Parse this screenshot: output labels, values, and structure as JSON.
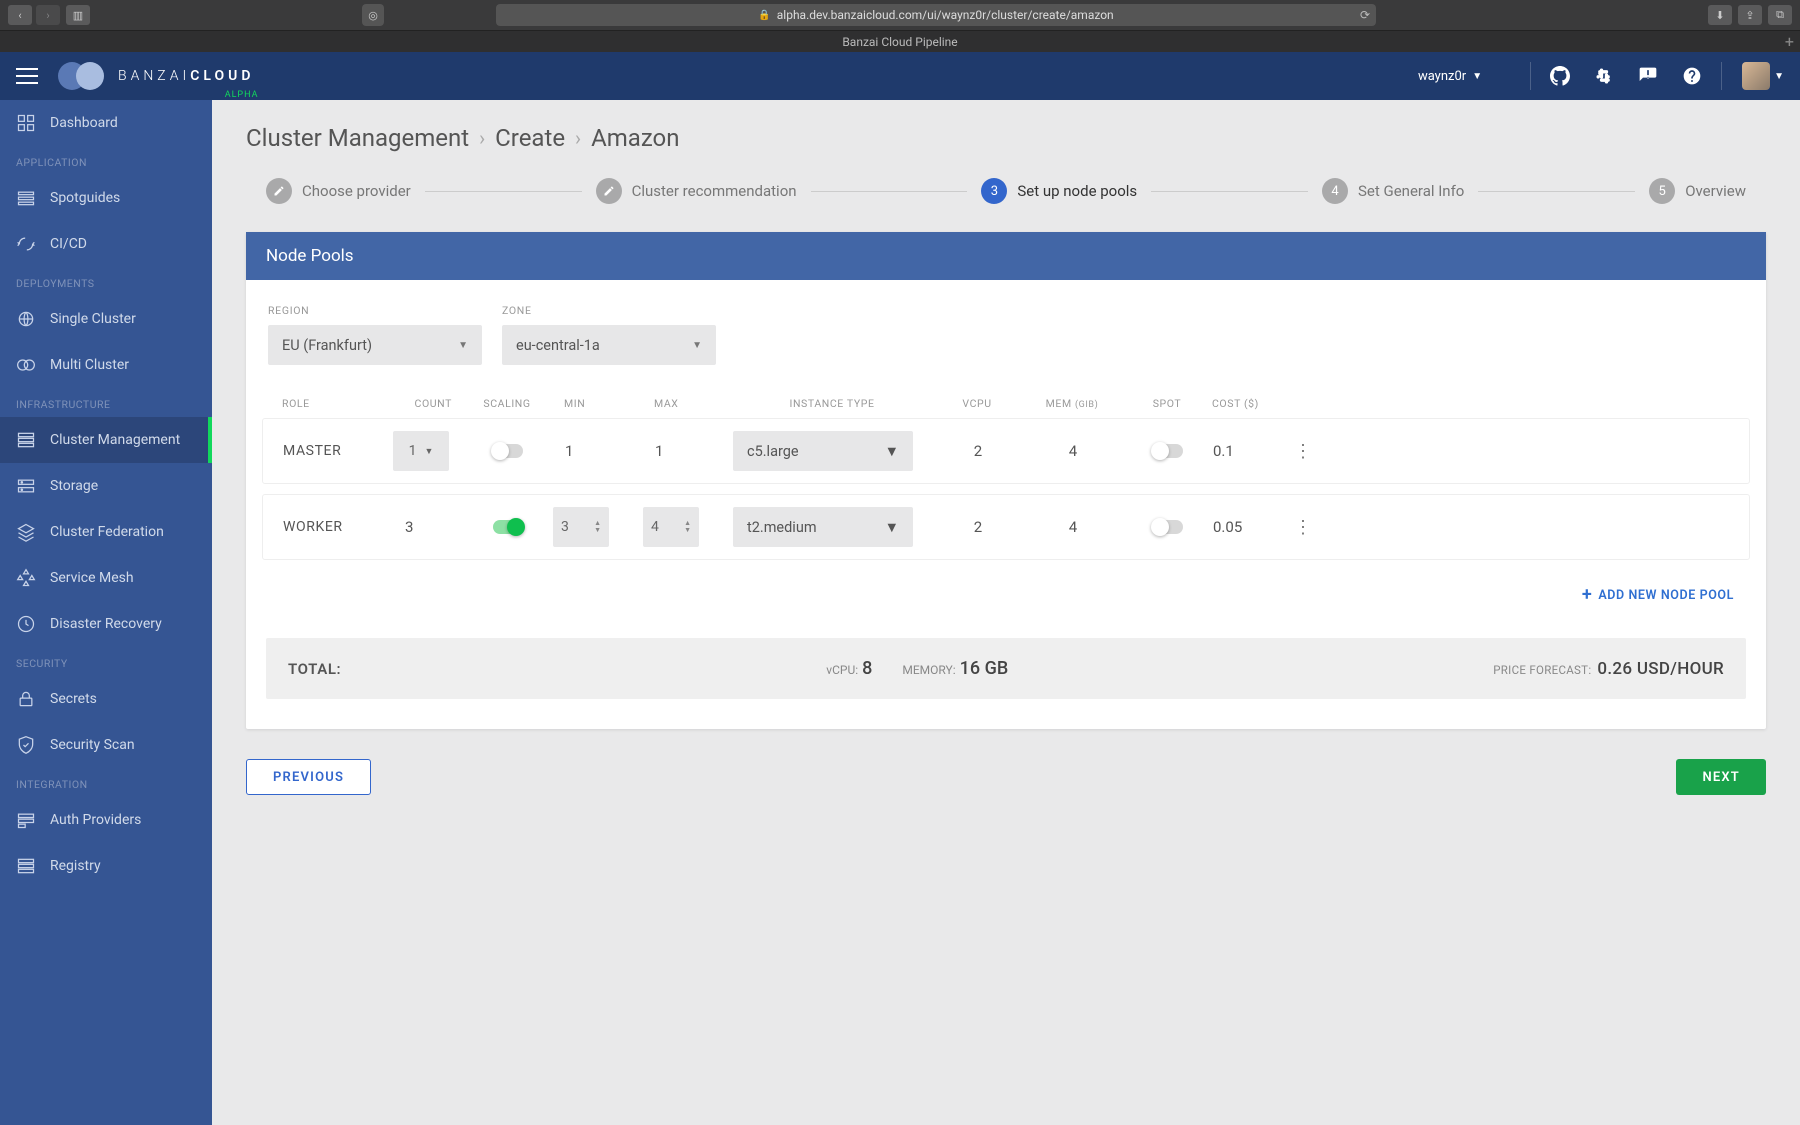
{
  "browser": {
    "url": "alpha.dev.banzaicloud.com/ui/waynz0r/cluster/create/amazon",
    "tab_title": "Banzai Cloud Pipeline"
  },
  "brand": {
    "name_light": "BANZAI",
    "name_bold": "CLOUD",
    "badge": "ALPHA"
  },
  "user": {
    "name": "waynz0r"
  },
  "sidebar": {
    "top": [
      {
        "label": "Dashboard",
        "icon": "dashboard"
      }
    ],
    "sections": [
      {
        "title": "APPLICATION",
        "items": [
          {
            "label": "Spotguides",
            "icon": "spotguides"
          },
          {
            "label": "CI/CD",
            "icon": "cicd"
          }
        ]
      },
      {
        "title": "DEPLOYMENTS",
        "items": [
          {
            "label": "Single Cluster",
            "icon": "single"
          },
          {
            "label": "Multi Cluster",
            "icon": "multi"
          }
        ]
      },
      {
        "title": "INFRASTRUCTURE",
        "items": [
          {
            "label": "Cluster Management",
            "icon": "cluster",
            "active": true
          },
          {
            "label": "Storage",
            "icon": "storage"
          },
          {
            "label": "Cluster Federation",
            "icon": "federation"
          },
          {
            "label": "Service Mesh",
            "icon": "mesh"
          },
          {
            "label": "Disaster Recovery",
            "icon": "recovery"
          }
        ]
      },
      {
        "title": "SECURITY",
        "items": [
          {
            "label": "Secrets",
            "icon": "secrets"
          },
          {
            "label": "Security Scan",
            "icon": "scan"
          }
        ]
      },
      {
        "title": "INTEGRATION",
        "items": [
          {
            "label": "Auth Providers",
            "icon": "auth"
          },
          {
            "label": "Registry",
            "icon": "registry"
          }
        ]
      }
    ]
  },
  "breadcrumb": [
    "Cluster Management",
    "Create",
    "Amazon"
  ],
  "stepper": [
    {
      "label": "Choose provider",
      "state": "done"
    },
    {
      "label": "Cluster recommendation",
      "state": "done"
    },
    {
      "num": "3",
      "label": "Set up node pools",
      "state": "active"
    },
    {
      "num": "4",
      "label": "Set General Info",
      "state": "todo"
    },
    {
      "num": "5",
      "label": "Overview",
      "state": "todo"
    }
  ],
  "panel": {
    "title": "Node Pools",
    "region_label": "REGION",
    "region_value": "EU (Frankfurt)",
    "zone_label": "ZONE",
    "zone_value": "eu-central-1a",
    "columns": {
      "role": "ROLE",
      "count": "COUNT",
      "scaling": "SCALING",
      "min": "MIN",
      "max": "MAX",
      "instance": "INSTANCE TYPE",
      "vcpu": "VCPU",
      "mem": "MEM",
      "mem_unit": "(GIB)",
      "spot": "SPOT",
      "cost": "COST ($)"
    },
    "rows": [
      {
        "role": "MASTER",
        "count": "1",
        "count_editable": true,
        "scaling": false,
        "min": "1",
        "max": "1",
        "min_editable": false,
        "max_editable": false,
        "instance": "c5.large",
        "vcpu": "2",
        "mem": "4",
        "spot": false,
        "cost": "0.1"
      },
      {
        "role": "WORKER",
        "count": "3",
        "count_editable": false,
        "scaling": true,
        "min": "3",
        "max": "4",
        "min_editable": true,
        "max_editable": true,
        "instance": "t2.medium",
        "vcpu": "2",
        "mem": "4",
        "spot": false,
        "cost": "0.05"
      }
    ],
    "add_label": "ADD NEW NODE POOL",
    "totals": {
      "label": "TOTAL:",
      "vcpu_label": "vCPU:",
      "vcpu": "8",
      "mem_label": "MEMORY:",
      "mem": "16 GB",
      "price_label": "PRICE FORECAST:",
      "price": "0.26 USD/HOUR"
    }
  },
  "nav": {
    "prev": "PREVIOUS",
    "next": "NEXT"
  }
}
